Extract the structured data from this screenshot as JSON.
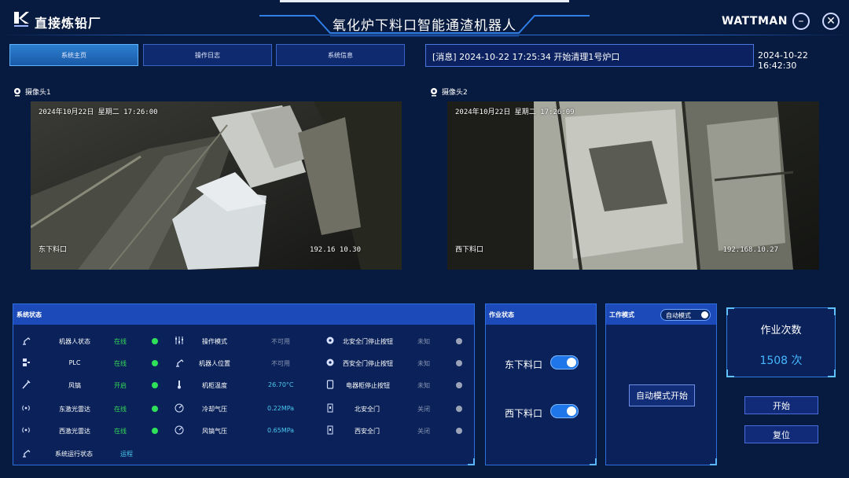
{
  "header": {
    "brand": "直接炼铅厂",
    "title": "氧化炉下料口智能通渣机器人",
    "company": "WATTMAN",
    "minimize_icon": "minus-icon",
    "close_icon": "close-icon"
  },
  "tabs": [
    {
      "label": "系统主页",
      "active": true
    },
    {
      "label": "操作日志",
      "active": false
    },
    {
      "label": "系统信息",
      "active": false
    }
  ],
  "message": "[消息] 2024-10-22 17:25:34 开始清理1号炉口",
  "clock": "2024-10-22 16:42:30",
  "cameras": [
    {
      "label": "摄像头1",
      "timestamp": "2024年10月22日 星期二 17:26:00",
      "location": "东下料口",
      "ip": "192.16  10.30"
    },
    {
      "label": "摄像头2",
      "timestamp": "2024年10月22日 星期二 17:26:09",
      "location": "西下料口",
      "ip": "192.168.10.27"
    }
  ],
  "system_status": {
    "title": "系统状态",
    "col1": [
      {
        "icon": "robot-arm-icon",
        "label": "机器人状态",
        "value": "在线",
        "dot": "green"
      },
      {
        "icon": "plc-icon",
        "label": "PLC",
        "value": "在线",
        "dot": "green"
      },
      {
        "icon": "air-gun-icon",
        "label": "风镐",
        "value": "开启",
        "dot": "green"
      },
      {
        "icon": "radar-icon",
        "label": "东激光雷达",
        "value": "在线",
        "dot": "green"
      },
      {
        "icon": "radar-icon",
        "label": "西激光雷达",
        "value": "在线",
        "dot": "green"
      },
      {
        "icon": "robot-arm-icon",
        "label": "系统运行状态",
        "value": "运程"
      }
    ],
    "col2": [
      {
        "icon": "sliders-icon",
        "label": "操作模式",
        "value": "不可用"
      },
      {
        "icon": "robot-arm-icon",
        "label": "机器人位置",
        "value": "不可用"
      },
      {
        "icon": "thermometer-icon",
        "label": "机柜温度",
        "value": "26.70°C"
      },
      {
        "icon": "gauge-icon",
        "label": "冷却气压",
        "value": "0.22MPa"
      },
      {
        "icon": "gauge-icon",
        "label": "风镐气压",
        "value": "0.65MPa"
      }
    ],
    "col3": [
      {
        "icon": "gear-icon",
        "label": "北安全门停止按钮",
        "value": "未知",
        "dot": "gray"
      },
      {
        "icon": "gear-icon",
        "label": "西安全门停止按钮",
        "value": "未知",
        "dot": "gray"
      },
      {
        "icon": "cabinet-icon",
        "label": "电器柜停止按钮",
        "value": "未知",
        "dot": "gray"
      },
      {
        "icon": "door-icon",
        "label": "北安全门",
        "value": "关闭",
        "dot": "gray"
      },
      {
        "icon": "door-icon",
        "label": "西安全门",
        "value": "关闭",
        "dot": "gray"
      }
    ]
  },
  "job_status": {
    "title": "作业状态",
    "items": [
      {
        "label": "东下料口",
        "on": true
      },
      {
        "label": "西下料口",
        "on": true
      }
    ]
  },
  "work_mode": {
    "title": "工作模式",
    "mode": "自动模式",
    "start_label": "自动模式开始"
  },
  "counter": {
    "title": "作业次数",
    "value": "1508 次"
  },
  "actions": {
    "start": "开始",
    "reset": "复位"
  },
  "colors": {
    "bg": "#071a3f",
    "panel_head": "#1c4ab8",
    "online": "#35d957",
    "accent": "#45b8ff"
  }
}
